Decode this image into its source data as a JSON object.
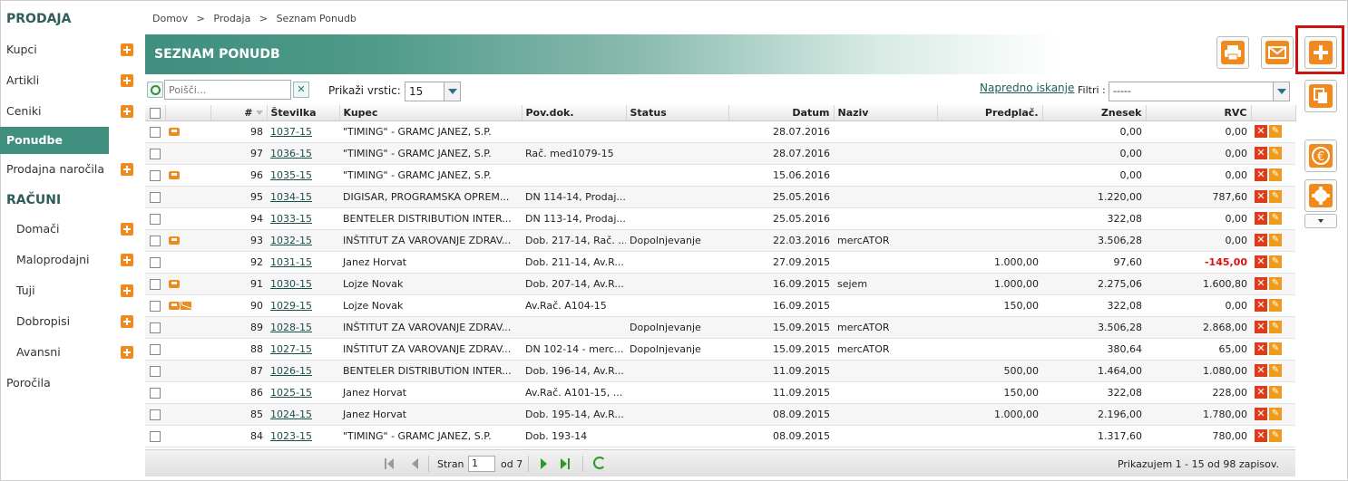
{
  "sidebar": {
    "section_prodaja": "PRODAJA",
    "section_racuni": "RAČUNI",
    "items": [
      {
        "label": "Kupci"
      },
      {
        "label": "Artikli"
      },
      {
        "label": "Ceniki"
      },
      {
        "label": "Ponudbe"
      },
      {
        "label": "Prodajna naročila"
      },
      {
        "label": "Domači"
      },
      {
        "label": "Maloprodajni"
      },
      {
        "label": "Tuji"
      },
      {
        "label": "Dobropisi"
      },
      {
        "label": "Avansni"
      },
      {
        "label": "Poročila"
      }
    ]
  },
  "breadcrumb": {
    "home": "Domov",
    "sep1": ">",
    "mid": "Prodaja",
    "sep2": ">",
    "current": "Seznam Ponudb"
  },
  "header": {
    "title": "SEZNAM PONUDB"
  },
  "toolbar": {
    "search_placeholder": "Poišči...",
    "clear_label": "✕",
    "rows_label": "Prikaži vrstic:",
    "rows_value": "15",
    "advanced_search": "Napredno iskanje",
    "filter_label": "Filtri :",
    "filter_value": "-----"
  },
  "table": {
    "columns": {
      "num": "#",
      "stevilka": "Številka",
      "kupec": "Kupec",
      "povdok": "Pov.dok.",
      "status": "Status",
      "datum": "Datum",
      "naziv": "Naziv",
      "predplac": "Predplač.",
      "znesek": "Znesek",
      "rvc": "RVC"
    },
    "rows": [
      {
        "n": "98",
        "st": "1037-15",
        "kupec": "\"TIMING\" - GRAMC JANEZ, S.P.",
        "pov": "",
        "status": "",
        "datum": "28.07.2016",
        "naziv": "",
        "pred": "",
        "znesek": "0,00",
        "rvc": "0,00"
      },
      {
        "n": "97",
        "st": "1036-15",
        "kupec": "\"TIMING\" - GRAMC JANEZ, S.P.",
        "pov": "Rač. med1079-15",
        "status": "",
        "datum": "28.07.2016",
        "naziv": "",
        "pred": "",
        "znesek": "0,00",
        "rvc": "0,00"
      },
      {
        "n": "96",
        "st": "1035-15",
        "kupec": "\"TIMING\" - GRAMC JANEZ, S.P.",
        "pov": "",
        "status": "",
        "datum": "15.06.2016",
        "naziv": "",
        "pred": "",
        "znesek": "0,00",
        "rvc": "0,00"
      },
      {
        "n": "95",
        "st": "1034-15",
        "kupec": "DIGISAR, PROGRAMSKA OPREM...",
        "pov": "DN 114-14, Prodaj...",
        "status": "",
        "datum": "25.05.2016",
        "naziv": "",
        "pred": "",
        "znesek": "1.220,00",
        "rvc": "787,60"
      },
      {
        "n": "94",
        "st": "1033-15",
        "kupec": "BENTELER DISTRIBUTION INTER...",
        "pov": "DN 113-14, Prodaj...",
        "status": "",
        "datum": "25.05.2016",
        "naziv": "",
        "pred": "",
        "znesek": "322,08",
        "rvc": "0,00"
      },
      {
        "n": "93",
        "st": "1032-15",
        "kupec": "INŠTITUT ZA VAROVANJE ZDRAV...",
        "pov": "Dob. 217-14, Rač. ...",
        "status": "Dopolnjevanje",
        "datum": "22.03.2016",
        "naziv": "mercATOR",
        "pred": "",
        "znesek": "3.506,28",
        "rvc": "0,00"
      },
      {
        "n": "92",
        "st": "1031-15",
        "kupec": "Janez Horvat",
        "pov": "Dob. 211-14, Av.R...",
        "status": "",
        "datum": "27.09.2015",
        "naziv": "",
        "pred": "1.000,00",
        "znesek": "97,60",
        "rvc": "-145,00"
      },
      {
        "n": "91",
        "st": "1030-15",
        "kupec": "Lojze Novak",
        "pov": "Dob. 207-14, Av.R...",
        "status": "",
        "datum": "16.09.2015",
        "naziv": "sejem",
        "pred": "1.000,00",
        "znesek": "2.275,06",
        "rvc": "1.600,80"
      },
      {
        "n": "90",
        "st": "1029-15",
        "kupec": "Lojze Novak",
        "pov": "Av.Rač. A104-15",
        "status": "",
        "datum": "16.09.2015",
        "naziv": "",
        "pred": "150,00",
        "znesek": "322,08",
        "rvc": "0,00"
      },
      {
        "n": "89",
        "st": "1028-15",
        "kupec": "INŠTITUT ZA VAROVANJE ZDRAV...",
        "pov": "",
        "status": "Dopolnjevanje",
        "datum": "15.09.2015",
        "naziv": "mercATOR",
        "pred": "",
        "znesek": "3.506,28",
        "rvc": "2.868,00"
      },
      {
        "n": "88",
        "st": "1027-15",
        "kupec": "INŠTITUT ZA VAROVANJE ZDRAV...",
        "pov": "DN 102-14 - merc...",
        "status": "Dopolnjevanje",
        "datum": "15.09.2015",
        "naziv": "mercATOR",
        "pred": "",
        "znesek": "380,64",
        "rvc": "65,00"
      },
      {
        "n": "87",
        "st": "1026-15",
        "kupec": "BENTELER DISTRIBUTION INTER...",
        "pov": "Dob. 196-14, Av.R...",
        "status": "",
        "datum": "11.09.2015",
        "naziv": "",
        "pred": "500,00",
        "znesek": "1.464,00",
        "rvc": "1.080,00"
      },
      {
        "n": "86",
        "st": "1025-15",
        "kupec": "Janez Horvat",
        "pov": "Av.Rač. A101-15, ...",
        "status": "",
        "datum": "11.09.2015",
        "naziv": "",
        "pred": "150,00",
        "znesek": "322,08",
        "rvc": "228,00"
      },
      {
        "n": "85",
        "st": "1024-15",
        "kupec": "Janez Horvat",
        "pov": "Dob. 195-14, Av.R...",
        "status": "",
        "datum": "08.09.2015",
        "naziv": "",
        "pred": "1.000,00",
        "znesek": "2.196,00",
        "rvc": "1.780,00"
      },
      {
        "n": "84",
        "st": "1023-15",
        "kupec": "\"TIMING\" - GRAMC JANEZ, S.P.",
        "pov": "Dob. 193-14",
        "status": "",
        "datum": "08.09.2015",
        "naziv": "",
        "pred": "",
        "znesek": "1.317,60",
        "rvc": "780,00"
      }
    ]
  },
  "pager": {
    "page_label": "Stran",
    "page_value": "1",
    "of_label": "od 7",
    "info": "Prikazujem 1 - 15 od 98 zapisov."
  },
  "colors": {
    "accent": "#3f8e7e",
    "orange": "#f08a1c",
    "highlight": "#cc1111"
  },
  "icons": {
    "add": "plus-icon",
    "print": "printer-icon",
    "mail": "envelope-icon",
    "copy": "copy-icon",
    "currency": "euro-icon",
    "settings": "gear-icon"
  }
}
